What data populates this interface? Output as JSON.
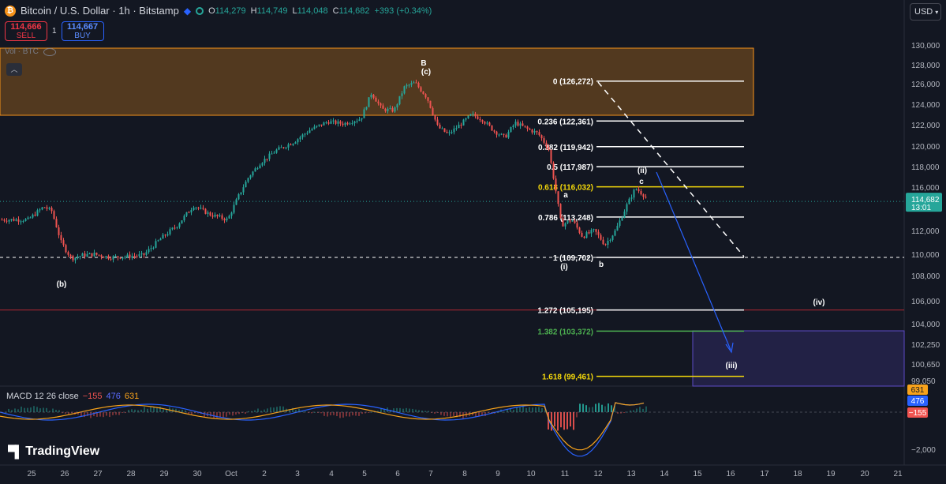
{
  "header": {
    "coin_symbol": "₿",
    "title": "Bitcoin / U.S. Dollar · 1h · Bitstamp",
    "o_label": "O",
    "o": "114,279",
    "h_label": "H",
    "h": "114,749",
    "l_label": "L",
    "l": "114,048",
    "c_label": "C",
    "c": "114,682",
    "change": "+393 (+0.34%)"
  },
  "trade": {
    "sell_price": "114,666",
    "sell_label": "SELL",
    "spread": "1",
    "buy_price": "114,667",
    "buy_label": "BUY"
  },
  "volume_label": "Vol · BTC",
  "currency": "USD",
  "macd": {
    "label": "MACD 12 26 close",
    "hist": "−155",
    "macd": "476",
    "signal": "631"
  },
  "logo_text": "TradingView",
  "colors": {
    "up": "#26a69a",
    "down": "#ef5350",
    "zone": "#f7931a",
    "purple_zone": "#5c4bc6",
    "fib_white": "#ffffff",
    "fib_gold": "#f5d90a",
    "fib_green": "#4caf50"
  },
  "chart_data": {
    "type": "candlestick",
    "title": "",
    "y_axis": {
      "ticks": [
        "130,000",
        "128,000",
        "126,000",
        "124,000",
        "122,000",
        "120,000",
        "118,000",
        "116,000",
        "112,000",
        "110,000",
        "108,000",
        "106,000",
        "104,000",
        "102,250",
        "100,650",
        "99,050"
      ],
      "range": [
        99050,
        130000
      ]
    },
    "x_axis": {
      "ticks": [
        "25",
        "26",
        "27",
        "28",
        "29",
        "30",
        "Oct",
        "2",
        "3",
        "4",
        "5",
        "6",
        "7",
        "8",
        "9",
        "10",
        "11",
        "12",
        "13",
        "14",
        "15",
        "16",
        "17",
        "18",
        "19",
        "20",
        "21"
      ]
    },
    "current_price": {
      "value": "114,682",
      "countdown": "13:01"
    },
    "fib_levels": [
      {
        "label": "0 (126,272)",
        "value": 126272
      },
      {
        "label": "0.236 (122,361)",
        "value": 122361
      },
      {
        "label": "0.382 (119,942)",
        "value": 119942
      },
      {
        "label": "0.5 (117,987)",
        "value": 117987
      },
      {
        "label": "0.618 (116,032)",
        "value": 116032
      },
      {
        "label": "0.786 (113,248)",
        "value": 113248
      },
      {
        "label": "1 (109,702)",
        "value": 109702
      },
      {
        "label": "1.272 (105,195)",
        "value": 105195
      },
      {
        "label": "1.382 (103,372)",
        "value": 103372
      },
      {
        "label": "1.618 (99,461)",
        "value": 99461
      }
    ],
    "wave_labels": [
      "B",
      "(c)",
      "(b)",
      "a",
      "(i)",
      "b",
      "(ii)",
      "c",
      "(iv)",
      "(iii)"
    ],
    "price_path": [
      [
        "25",
        113000
      ],
      [
        "25",
        113600
      ],
      [
        "25",
        114200
      ],
      [
        "25",
        113800
      ],
      [
        "26",
        111000
      ],
      [
        "26",
        109600
      ],
      [
        "26",
        109900
      ],
      [
        "27",
        110000
      ],
      [
        "27",
        109700
      ],
      [
        "28",
        109800
      ],
      [
        "28",
        109900
      ],
      [
        "29",
        111300
      ],
      [
        "29",
        112400
      ],
      [
        "30",
        114300
      ],
      [
        "30",
        113500
      ],
      [
        "Oct",
        113000
      ],
      [
        "Oct",
        115100
      ],
      [
        "Oct",
        117000
      ],
      [
        "2",
        118400
      ],
      [
        "2",
        119600
      ],
      [
        "3",
        120400
      ],
      [
        "3",
        121500
      ],
      [
        "4",
        122300
      ],
      [
        "4",
        122100
      ],
      [
        "5",
        122600
      ],
      [
        "5",
        125100
      ],
      [
        "5",
        123500
      ],
      [
        "6",
        123400
      ],
      [
        "6",
        125700
      ],
      [
        "6",
        126100
      ],
      [
        "7",
        124600
      ],
      [
        "7",
        121800
      ],
      [
        "7",
        121100
      ],
      [
        "8",
        122100
      ],
      [
        "8",
        123000
      ],
      [
        "8",
        122500
      ],
      [
        "9",
        121400
      ],
      [
        "9",
        120800
      ],
      [
        "9",
        122200
      ],
      [
        "10",
        121600
      ],
      [
        "10",
        121200
      ],
      [
        "10",
        119800
      ],
      [
        "11",
        112500
      ],
      [
        "11",
        113000
      ],
      [
        "11",
        111500
      ],
      [
        "12",
        112000
      ],
      [
        "12",
        110800
      ],
      [
        "12",
        112000
      ],
      [
        "13",
        114500
      ],
      [
        "13",
        115900
      ],
      [
        "13",
        115300
      ],
      [
        "13",
        114682
      ]
    ],
    "macd_axis_label": "−2,000"
  }
}
